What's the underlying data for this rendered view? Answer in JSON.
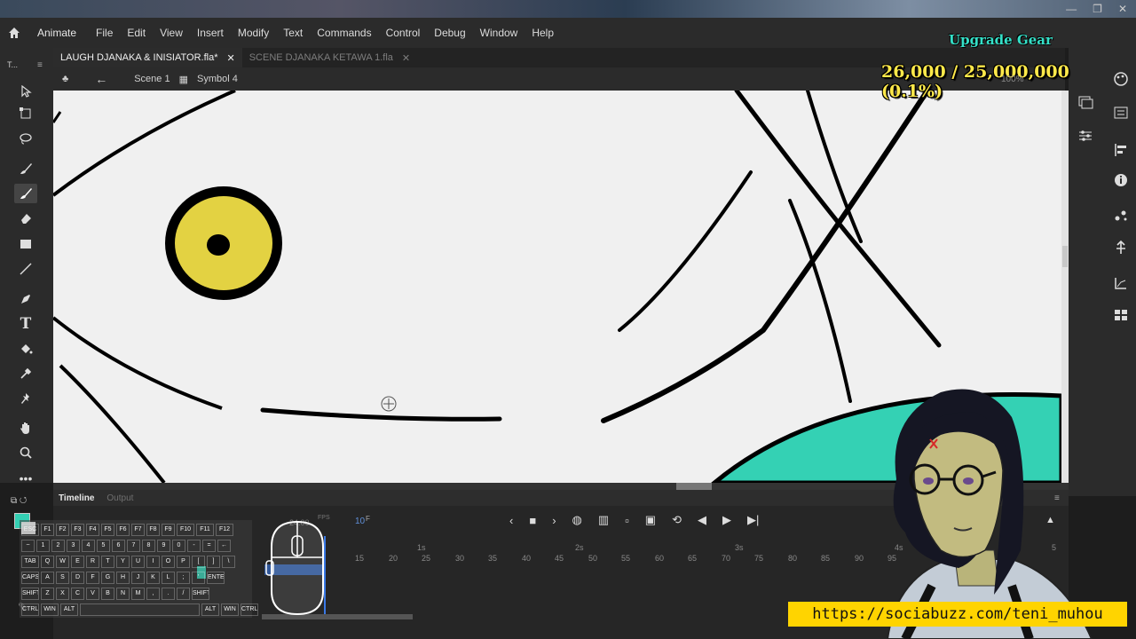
{
  "app": {
    "name": "Animate",
    "menu": [
      "File",
      "Edit",
      "View",
      "Insert",
      "Modify",
      "Text",
      "Commands",
      "Control",
      "Debug",
      "Window",
      "Help"
    ]
  },
  "documents": {
    "tabs": [
      {
        "label": "LAUGH DJANAKA & INISIATOR.fla*",
        "active": true
      },
      {
        "label": "SCENE DJANAKA KETAWA 1.fla",
        "active": false
      }
    ]
  },
  "scene": {
    "scene_label": "Scene 1",
    "symbol_label": "Symbol 4",
    "zoom": "100%"
  },
  "tools_panel": {
    "title": "T..."
  },
  "timeline": {
    "tab_timeline": "Timeline",
    "tab_output": "Output",
    "fps_label": "FPS",
    "fps_value": "24.00",
    "current_frame": "10",
    "frame_suffix": "F",
    "seconds": [
      "1s",
      "2s",
      "3s",
      "4s",
      "5"
    ],
    "frame_numbers": [
      "15",
      "20",
      "25",
      "30",
      "35",
      "40",
      "45",
      "50",
      "55",
      "60",
      "65",
      "70",
      "75",
      "80",
      "85",
      "90",
      "95"
    ]
  },
  "keyboard_overlay": {
    "rows": [
      [
        "ESC",
        "F1",
        "F2",
        "F3",
        "F4",
        "F5",
        "F6",
        "F7",
        "F8",
        "F9",
        "F10",
        "F11",
        "F12"
      ],
      [
        "~",
        "1",
        "2",
        "3",
        "4",
        "5",
        "6",
        "7",
        "8",
        "9",
        "0",
        "-",
        "=",
        "←"
      ],
      [
        "TAB",
        "Q",
        "W",
        "E",
        "R",
        "T",
        "Y",
        "U",
        "I",
        "O",
        "P",
        "[",
        "]",
        "\\"
      ],
      [
        "CAPS",
        "A",
        "S",
        "D",
        "F",
        "G",
        "H",
        "J",
        "K",
        "L",
        ";",
        "'",
        "ENTER"
      ],
      [
        "SHIFT",
        "Z",
        "X",
        "C",
        "V",
        "B",
        "N",
        "M",
        ",",
        ".",
        "/",
        "SHIFT"
      ],
      [
        "CTRL",
        "WIN",
        "ALT",
        "",
        "ALT",
        "WIN",
        "CTRL"
      ]
    ]
  },
  "overlay": {
    "upgrade_text": "Upgrade Gear",
    "counter_text": "26,000 / 25,000,000 (0.1%)",
    "url": "https://sociabuzz.com/teni_muhou"
  },
  "colors": {
    "stage_bg": "#f0f0f0",
    "eye_fill": "#e3d242",
    "hill_fill": "#34d1b4",
    "accent_blue": "#3a79e6",
    "gear_text": "#35e0c8",
    "counter_text": "#ffe94a"
  }
}
